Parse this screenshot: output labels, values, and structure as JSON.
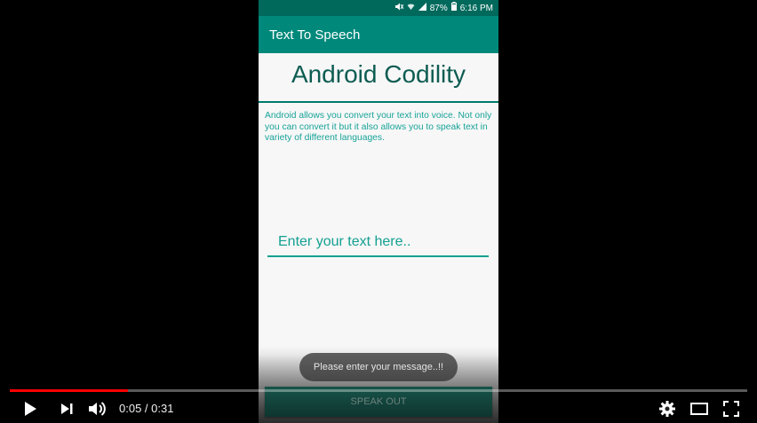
{
  "status_bar": {
    "battery": "87%",
    "time": "6:16 PM"
  },
  "app": {
    "title": "Text To Speech",
    "brand": "Android Codility",
    "description": "Android allows you convert your text into voice. Not only you can convert it but it also allows you to speak text in variety of different languages.",
    "input": {
      "placeholder": "Enter your text here..",
      "value": ""
    },
    "toast": "Please enter your message..!!",
    "speak_button": "SPEAK OUT",
    "colors": {
      "app_bar": "#00897b",
      "status_bar": "#00695c",
      "accent": "#14a091"
    }
  },
  "player": {
    "time_display": "0:05 / 0:31",
    "progress_fraction": 0.16,
    "icons": [
      "play-icon",
      "next-icon",
      "volume-icon",
      "settings-icon",
      "theater-mode-icon",
      "fullscreen-icon"
    ],
    "progress_color": "#ff0000"
  }
}
